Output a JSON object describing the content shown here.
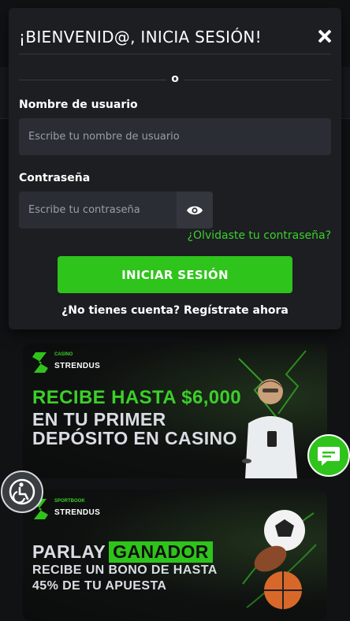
{
  "login_modal": {
    "title": "¡BIENVENID@, INICIA SESIÓN!",
    "close_icon": "close-icon",
    "separator_text": "o",
    "username": {
      "label": "Nombre de usuario",
      "placeholder": "Escribe tu nombre de usuario",
      "value": ""
    },
    "password": {
      "label": "Contraseña",
      "placeholder": "Escribe tu contraseña",
      "value": "",
      "toggle_icon": "eye-icon"
    },
    "forgot_link": "¿Olvidaste tu contraseña?",
    "submit_label": "INICIAR SESIÓN",
    "register_link": "¿No tienes cuenta? Regístrate ahora"
  },
  "banners": [
    {
      "logo_small": "CASINO",
      "logo_brand": "STRENDUS",
      "lines": [
        "RECIBE HASTA $6,000",
        "EN TU PRIMER",
        "DEPÓSITO EN CASINO"
      ]
    },
    {
      "logo_small": "SPORTBOOK",
      "logo_brand": "STRENDUS",
      "line1_a": "PARLAY",
      "line1_b": "GANADOR",
      "lines": [
        "RECIBE UN BONO DE HASTA",
        "45% DE TU APUESTA"
      ]
    }
  ],
  "floating": {
    "chat_icon": "chat-icon",
    "accessibility_icon": "accessibility-icon"
  },
  "colors": {
    "accent_green": "#2fc41b",
    "modal_bg": "#1c1e22",
    "input_bg": "#2a2d33",
    "link_green": "#3ccf2a"
  }
}
